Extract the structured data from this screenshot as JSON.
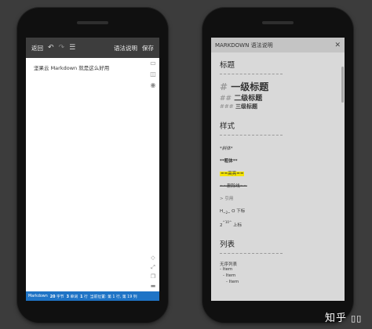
{
  "editor": {
    "toolbar": {
      "back_label": "返回",
      "undo_icon": "undo-icon",
      "redo_icon": "redo-icon",
      "menu_icon": "menu-icon",
      "syntax_label": "语法说明",
      "save_label": "保存"
    },
    "content": "坚果云 Markdown 就是这么好用",
    "status": {
      "mode": "Markdown",
      "bytes_value": "20",
      "bytes_unit": "字节",
      "words_value": "3",
      "words_unit": "单词",
      "lines_value": "1",
      "lines_unit": "行",
      "position": "当前位置: 第 1 行, 第 19 列"
    },
    "colors": {
      "status_bar": "#1f74c6",
      "toolbar": "#3d3d3d"
    }
  },
  "syntax": {
    "title": "MARKDOWN 语法说明",
    "close_label": "✕",
    "sections": {
      "headings": "标题",
      "styles": "样式",
      "lists": "列表"
    },
    "heading_examples": {
      "h1_mark": "#",
      "h1_text": "一级标题",
      "h2_mark": "##",
      "h2_text": "二级标题",
      "h3_mark": "###",
      "h3_text": "三级标题"
    },
    "style_examples": {
      "italic": "*斜体*",
      "bold": "**粗体**",
      "highlight": "==高亮==",
      "strike": "~~删除线~~",
      "quote": "> 引用",
      "sub_h": "H",
      "sub_marker": "~2~",
      "sub_rest": "O 下标",
      "sup_base": "2",
      "sup_marker": "^10^",
      "sup_rest": "上标"
    },
    "list_examples": {
      "title": "无序列表",
      "item1": "- Item",
      "item2": "- Item",
      "item3": "- Item"
    },
    "colors": {
      "highlight": "#f5e400",
      "panel": "#d9d9d9"
    }
  },
  "watermark": "知乎"
}
